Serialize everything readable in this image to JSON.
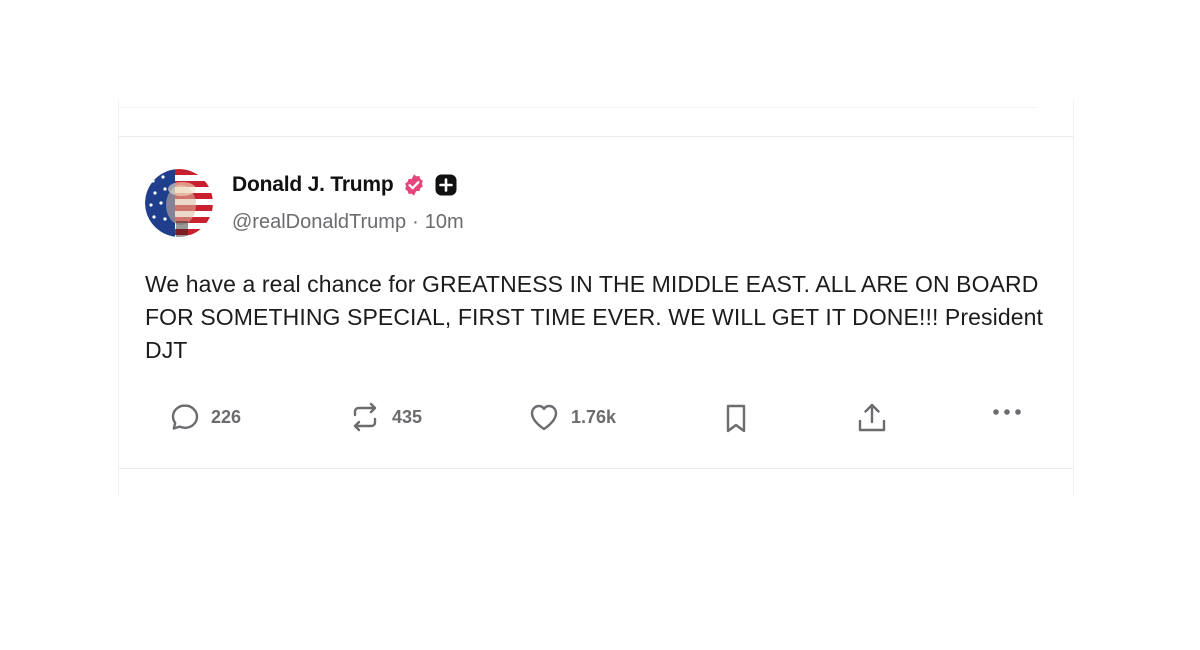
{
  "post": {
    "author": {
      "display_name": "Donald J. Trump",
      "handle": "@realDonaldTrump",
      "verified_color": "#e5457a"
    },
    "separator": "·",
    "time_ago": "10m",
    "text": "We have a real chance for GREATNESS IN THE MIDDLE EAST. ALL ARE ON BOARD FOR SOMETHING SPECIAL, FIRST TIME EVER. WE WILL GET IT DONE!!! President DJT",
    "actions": {
      "replies": "226",
      "reposts": "435",
      "likes": "1.76k"
    }
  },
  "icons": {
    "reply": "speech-bubble-icon",
    "repost": "repost-arrows-icon",
    "like": "heart-icon",
    "bookmark": "bookmark-icon",
    "share": "share-upload-icon",
    "more": "more-dots-icon",
    "verified": "verified-badge-icon",
    "plus_badge": "plus-badge-icon"
  },
  "colors": {
    "text": "#1c1c1e",
    "muted": "#6b6b70",
    "verified": "#e5457a",
    "divider": "#ececec"
  }
}
